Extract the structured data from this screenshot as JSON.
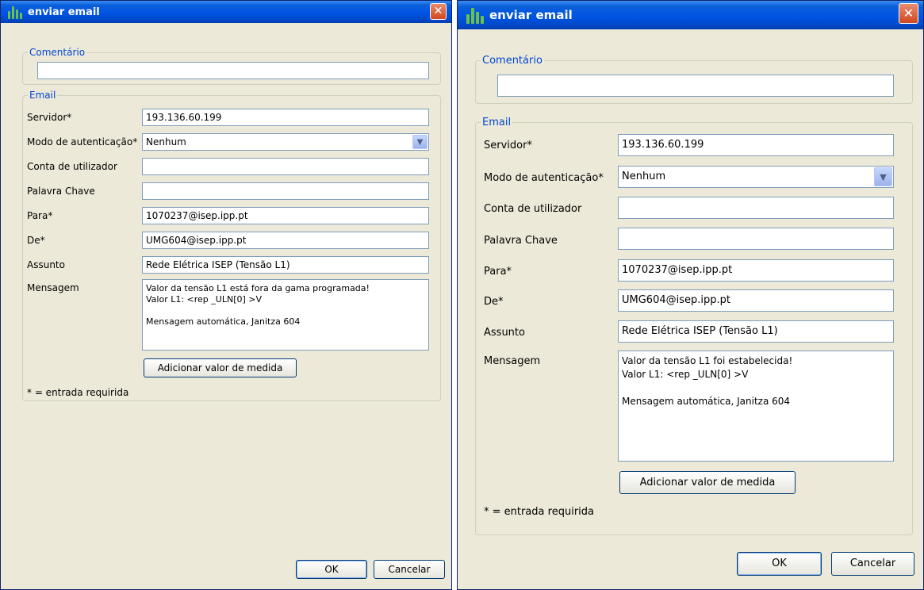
{
  "windows": [
    {
      "title": "enviar email",
      "comment_group": {
        "legend": "Comentário",
        "value": ""
      },
      "email_group": {
        "legend": "Email",
        "fields": [
          {
            "label": "Servidor*",
            "value": "193.136.60.199"
          },
          {
            "label": "Modo de autenticação*",
            "value": "Nenhum"
          },
          {
            "label": "Conta de utilizador",
            "value": ""
          },
          {
            "label": "Palavra Chave",
            "value": ""
          },
          {
            "label": "Para*",
            "value": "1070237@isep.ipp.pt"
          },
          {
            "label": "De*",
            "value": "UMG604@isep.ipp.pt"
          },
          {
            "label": "Assunto",
            "value": "Rede Elétrica ISEP (Tensão L1)"
          }
        ],
        "message_label": "Mensagem",
        "message": "Valor da tensão L1 está fora da gama programada!\nValor L1: <rep _ULN[0] >V\n\nMensagem automática, Janitza 604",
        "add_button": "Adicionar valor de medida",
        "required_note": "* = entrada requirida"
      },
      "ok_button": "OK",
      "cancel_button": "Cancelar"
    },
    {
      "title": "enviar email",
      "comment_group": {
        "legend": "Comentário",
        "value": ""
      },
      "email_group": {
        "legend": "Email",
        "fields": [
          {
            "label": "Servidor*",
            "value": "193.136.60.199"
          },
          {
            "label": "Modo de autenticação*",
            "value": "Nenhum"
          },
          {
            "label": "Conta de utilizador",
            "value": ""
          },
          {
            "label": "Palavra Chave",
            "value": ""
          },
          {
            "label": "Para*",
            "value": "1070237@isep.ipp.pt"
          },
          {
            "label": "De*",
            "value": "UMG604@isep.ipp.pt"
          },
          {
            "label": "Assunto",
            "value": "Rede Elétrica ISEP (Tensão L1)"
          }
        ],
        "message_label": "Mensagem",
        "message": "Valor da tensão L1 foi estabelecida!\nValor L1: <rep _ULN[0] >V\n\nMensagem automática, Janitza 604",
        "add_button": "Adicionar valor de medida",
        "required_note": "* = entrada requirida"
      },
      "ok_button": "OK",
      "cancel_button": "Cancelar"
    }
  ]
}
